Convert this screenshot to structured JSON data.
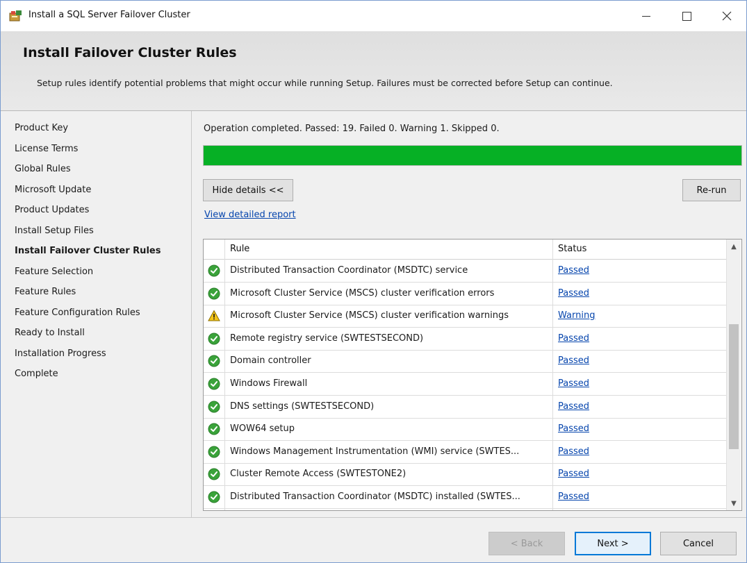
{
  "window": {
    "title": "Install a SQL Server Failover Cluster",
    "controls": {
      "minimize": "—",
      "maximize": "☐",
      "close": "✕"
    }
  },
  "header": {
    "title": "Install Failover Cluster Rules",
    "description": "Setup rules identify potential problems that might occur while running Setup. Failures must be corrected before Setup can continue."
  },
  "sidebar": {
    "items": [
      {
        "label": "Product Key",
        "current": false
      },
      {
        "label": "License Terms",
        "current": false
      },
      {
        "label": "Global Rules",
        "current": false
      },
      {
        "label": "Microsoft Update",
        "current": false
      },
      {
        "label": "Product Updates",
        "current": false
      },
      {
        "label": "Install Setup Files",
        "current": false
      },
      {
        "label": "Install Failover Cluster Rules",
        "current": true
      },
      {
        "label": "Feature Selection",
        "current": false
      },
      {
        "label": "Feature Rules",
        "current": false
      },
      {
        "label": "Feature Configuration Rules",
        "current": false
      },
      {
        "label": "Ready to Install",
        "current": false
      },
      {
        "label": "Installation Progress",
        "current": false
      },
      {
        "label": "Complete",
        "current": false
      }
    ]
  },
  "main": {
    "status_text": "Operation completed. Passed: 19.   Failed 0.   Warning 1.   Skipped 0.",
    "progress": 1.0,
    "progress_color": "#06b025",
    "hide_details_label": "Hide details <<",
    "rerun_label": "Re-run",
    "view_report_label": "View detailed report",
    "table": {
      "columns": [
        "Rule",
        "Status"
      ],
      "rows": [
        {
          "icon": "check-icon",
          "rule": "Distributed Transaction Coordinator (MSDTC) service",
          "status": "Passed"
        },
        {
          "icon": "check-icon",
          "rule": "Microsoft Cluster Service (MSCS) cluster verification errors",
          "status": "Passed"
        },
        {
          "icon": "warning-icon",
          "rule": "Microsoft Cluster Service (MSCS) cluster verification warnings",
          "status": "Warning"
        },
        {
          "icon": "check-icon",
          "rule": "Remote registry service (SWTESTSECOND)",
          "status": "Passed"
        },
        {
          "icon": "check-icon",
          "rule": "Domain controller",
          "status": "Passed"
        },
        {
          "icon": "check-icon",
          "rule": "Windows Firewall",
          "status": "Passed"
        },
        {
          "icon": "check-icon",
          "rule": "DNS settings (SWTESTSECOND)",
          "status": "Passed"
        },
        {
          "icon": "check-icon",
          "rule": "WOW64 setup",
          "status": "Passed"
        },
        {
          "icon": "check-icon",
          "rule": "Windows Management Instrumentation (WMI) service (SWTES...",
          "status": "Passed"
        },
        {
          "icon": "check-icon",
          "rule": "Cluster Remote Access (SWTESTONE2)",
          "status": "Passed"
        },
        {
          "icon": "check-icon",
          "rule": "Distributed Transaction Coordinator (MSDTC) installed (SWTES...",
          "status": "Passed"
        }
      ]
    },
    "scroll_position": 0.6
  },
  "footer": {
    "back_label": "< Back",
    "next_label": "Next >",
    "cancel_label": "Cancel"
  }
}
